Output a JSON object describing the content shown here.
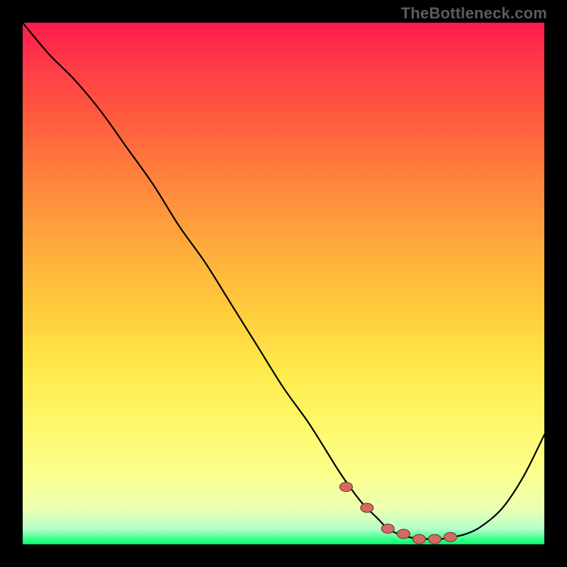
{
  "watermark": "TheBottleneck.com",
  "colors": {
    "background": "#000000",
    "curve": "#000000",
    "marker_fill": "#d46a64",
    "marker_stroke": "#6b2b24",
    "gradient_top": "#ff1a4d",
    "gradient_bottom": "#00ff6a"
  },
  "chart_data": {
    "type": "line",
    "title": "",
    "xlabel": "",
    "ylabel": "",
    "xlim": [
      0,
      100
    ],
    "ylim": [
      0,
      100
    ],
    "annotations": [],
    "series": [
      {
        "name": "bottleneck-curve",
        "x": [
          0,
          5,
          10,
          15,
          20,
          25,
          30,
          35,
          40,
          45,
          50,
          55,
          60,
          62,
          65,
          68,
          70,
          72,
          75,
          78,
          80,
          82,
          85,
          88,
          92,
          96,
          100
        ],
        "values": [
          100,
          94,
          89,
          83,
          76,
          69,
          61,
          54,
          46,
          38,
          30,
          23,
          15,
          12,
          8,
          5,
          3,
          2,
          1.2,
          1,
          1,
          1.3,
          2,
          3.5,
          7,
          13,
          21
        ]
      }
    ],
    "markers": {
      "name": "optimal-zone",
      "x": [
        62,
        66,
        70,
        73,
        76,
        79,
        82
      ],
      "values": [
        11,
        7,
        3,
        2,
        1,
        1,
        1.4
      ]
    }
  }
}
